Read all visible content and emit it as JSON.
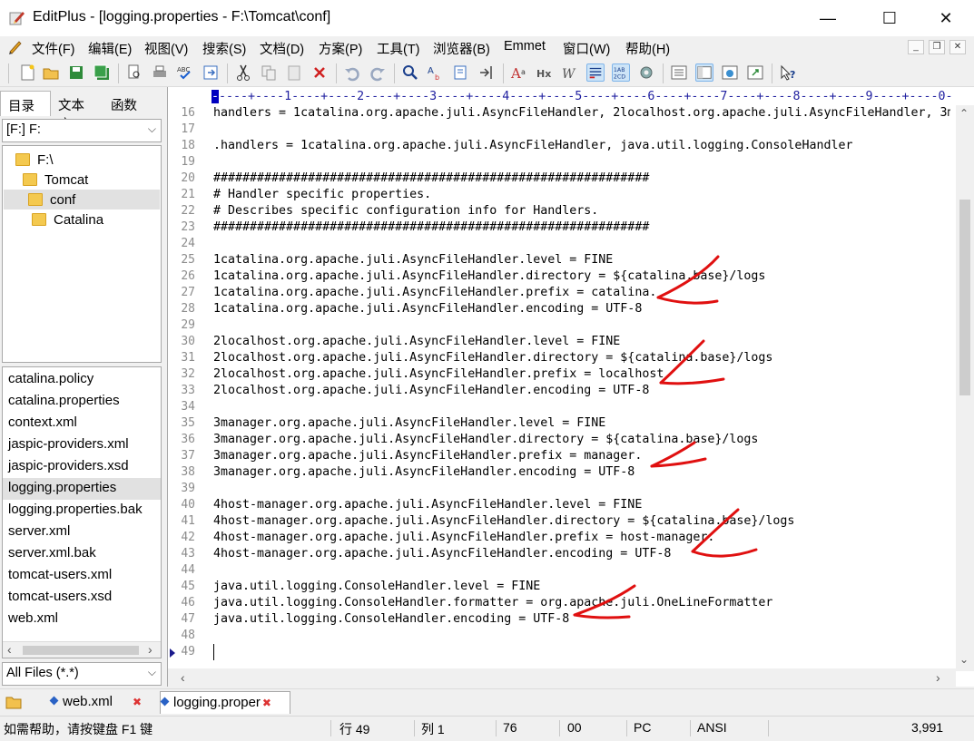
{
  "window": {
    "title": "EditPlus - [logging.properties - F:\\Tomcat\\conf]",
    "minimize": "—",
    "maximize": "☐",
    "close": "✕"
  },
  "menu": {
    "items": [
      "文件(F)",
      "编辑(E)",
      "视图(V)",
      "搜索(S)",
      "文档(D)",
      "方案(P)",
      "工具(T)",
      "浏览器(B)",
      "Emmet",
      "窗口(W)",
      "帮助(H)"
    ],
    "mdi_minimize": "_",
    "mdi_restore": "❐",
    "mdi_close": "✕"
  },
  "toolbar": {
    "icons": [
      "new-file-icon",
      "open-folder-icon",
      "save-icon",
      "save-all-icon",
      "print-preview-icon",
      "print-icon",
      "spell-check-icon",
      "refresh-icon",
      "cut-icon",
      "copy-icon",
      "paste-icon",
      "delete-icon",
      "undo-icon",
      "redo-icon",
      "find-icon",
      "replace-icon",
      "find-in-files-icon",
      "goto-line-icon",
      "font-icon",
      "hex-icon",
      "word-wrap-icon",
      "show-line-numbers-icon",
      "line-numbers-icon",
      "settings-icon",
      "panel-icon",
      "split-panel-icon",
      "browser-icon",
      "external-icon",
      "help-icon"
    ]
  },
  "left_panel": {
    "tabs": [
      "目录",
      "文本库",
      "函数"
    ],
    "drive": "[F:] F:",
    "tree": [
      {
        "label": "F:\\",
        "indent": 0
      },
      {
        "label": "Tomcat",
        "indent": 1
      },
      {
        "label": "conf",
        "indent": 2
      },
      {
        "label": "Catalina",
        "indent": 3
      }
    ],
    "files": [
      "catalina.policy",
      "catalina.properties",
      "context.xml",
      "jaspic-providers.xml",
      "jaspic-providers.xsd",
      "logging.properties",
      "logging.properties.bak",
      "server.xml",
      "server.xml.bak",
      "tomcat-users.xml",
      "tomcat-users.xsd",
      "web.xml"
    ],
    "selected_file": "logging.properties",
    "filter": "All Files (*.*)"
  },
  "editor": {
    "ruler": "----+----1----+----2----+----3----+----4----+----5----+----6----+----7----+----8----+----9----+----0---",
    "ruler_cursor": "-",
    "lines": [
      {
        "n": "16",
        "text": "handlers = 1catalina.org.apache.juli.AsyncFileHandler, 2localhost.org.apache.juli.AsyncFileHandler, 3m"
      },
      {
        "n": "17",
        "text": ""
      },
      {
        "n": "18",
        "text": ".handlers = 1catalina.org.apache.juli.AsyncFileHandler, java.util.logging.ConsoleHandler"
      },
      {
        "n": "19",
        "text": ""
      },
      {
        "n": "20",
        "text": "############################################################"
      },
      {
        "n": "21",
        "text": "# Handler specific properties."
      },
      {
        "n": "22",
        "text": "# Describes specific configuration info for Handlers."
      },
      {
        "n": "23",
        "text": "############################################################"
      },
      {
        "n": "24",
        "text": ""
      },
      {
        "n": "25",
        "text": "1catalina.org.apache.juli.AsyncFileHandler.level = FINE"
      },
      {
        "n": "26",
        "text": "1catalina.org.apache.juli.AsyncFileHandler.directory = ${catalina.base}/logs"
      },
      {
        "n": "27",
        "text": "1catalina.org.apache.juli.AsyncFileHandler.prefix = catalina."
      },
      {
        "n": "28",
        "text": "1catalina.org.apache.juli.AsyncFileHandler.encoding = UTF-8"
      },
      {
        "n": "29",
        "text": ""
      },
      {
        "n": "30",
        "text": "2localhost.org.apache.juli.AsyncFileHandler.level = FINE"
      },
      {
        "n": "31",
        "text": "2localhost.org.apache.juli.AsyncFileHandler.directory = ${catalina.base}/logs"
      },
      {
        "n": "32",
        "text": "2localhost.org.apache.juli.AsyncFileHandler.prefix = localhost."
      },
      {
        "n": "33",
        "text": "2localhost.org.apache.juli.AsyncFileHandler.encoding = UTF-8"
      },
      {
        "n": "34",
        "text": ""
      },
      {
        "n": "35",
        "text": "3manager.org.apache.juli.AsyncFileHandler.level = FINE"
      },
      {
        "n": "36",
        "text": "3manager.org.apache.juli.AsyncFileHandler.directory = ${catalina.base}/logs"
      },
      {
        "n": "37",
        "text": "3manager.org.apache.juli.AsyncFileHandler.prefix = manager."
      },
      {
        "n": "38",
        "text": "3manager.org.apache.juli.AsyncFileHandler.encoding = UTF-8"
      },
      {
        "n": "39",
        "text": ""
      },
      {
        "n": "40",
        "text": "4host-manager.org.apache.juli.AsyncFileHandler.level = FINE"
      },
      {
        "n": "41",
        "text": "4host-manager.org.apache.juli.AsyncFileHandler.directory = ${catalina.base}/logs"
      },
      {
        "n": "42",
        "text": "4host-manager.org.apache.juli.AsyncFileHandler.prefix = host-manager."
      },
      {
        "n": "43",
        "text": "4host-manager.org.apache.juli.AsyncFileHandler.encoding = UTF-8"
      },
      {
        "n": "44",
        "text": ""
      },
      {
        "n": "45",
        "text": "java.util.logging.ConsoleHandler.level = FINE"
      },
      {
        "n": "46",
        "text": "java.util.logging.ConsoleHandler.formatter = org.apache.juli.OneLineFormatter"
      },
      {
        "n": "47",
        "text": "java.util.logging.ConsoleHandler.encoding = UTF-8"
      },
      {
        "n": "48",
        "text": ""
      },
      {
        "n": "49",
        "text": ""
      }
    ]
  },
  "doc_tabs": [
    {
      "label": "web.xml",
      "active": false
    },
    {
      "label": "logging.proper",
      "active": true
    }
  ],
  "status": {
    "help": "如需帮助，请按键盘 F1 键",
    "row": "行 49",
    "col": "列 1",
    "chars": "76",
    "code": "00",
    "eol": "PC",
    "encoding": "ANSI",
    "size": "3,991"
  },
  "colors": {
    "annotation": "#e01010",
    "ruler": "#2020a0",
    "line_number": "#8c8c8c"
  }
}
